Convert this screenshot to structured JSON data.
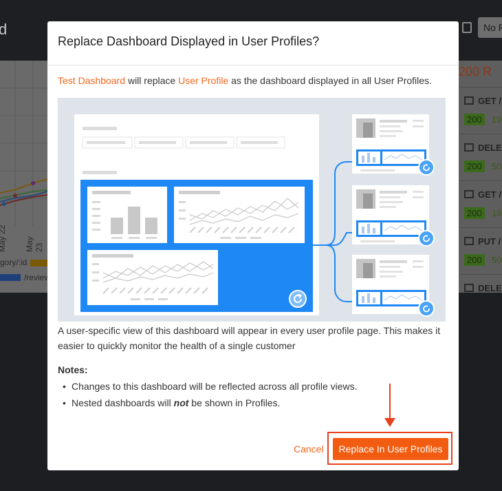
{
  "background": {
    "title_fragment": "d",
    "select_value": "No F",
    "chart": {
      "x_ticks": [
        "May 22",
        "May 23"
      ],
      "legend": [
        "gory/:id",
        "/review"
      ]
    },
    "right_panel": {
      "header": "200 R",
      "rows": [
        {
          "method": "GET /",
          "status": "200",
          "count": "19"
        },
        {
          "method": "DELE",
          "status": "200",
          "count": "50"
        },
        {
          "method": "GET /",
          "status": "200",
          "count": "19"
        },
        {
          "method": "PUT /",
          "status": "200",
          "count": "50"
        },
        {
          "method": "DELE",
          "status": "",
          "count": ""
        }
      ]
    }
  },
  "modal": {
    "title": "Replace Dashboard Displayed in User Profiles?",
    "intro": {
      "dashboard_name": "Test Dashboard",
      "middle": " will replace ",
      "profile_name": "User Profile",
      "end": " as the dashboard displayed in all User Profiles."
    },
    "description": "A user-specific view of this dashboard will appear in every user profile page. This makes it easier to quickly monitor the health of a single customer",
    "notes_title": "Notes:",
    "notes": {
      "first": "Changes to this dashboard will be reflected across all profile views.",
      "second_before": "Nested dashboards will ",
      "second_emphasis": "not",
      "second_after": " be shown in Profiles."
    },
    "cancel_label": "Cancel",
    "confirm_label": "Replace In User Profiles"
  },
  "colors": {
    "accent": "#f2661e",
    "primary_button": "#f25c10",
    "highlight_outline": "#e8401c",
    "illustration_blue": "#1e88f5"
  }
}
